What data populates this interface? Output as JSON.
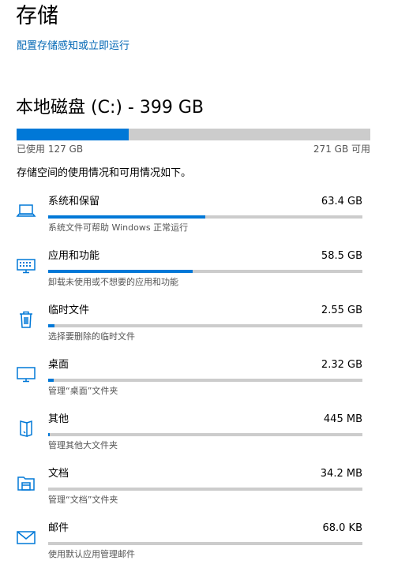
{
  "header": {
    "title": "存储",
    "config_link": "配置存储感知或立即运行"
  },
  "drive": {
    "title": "本地磁盘 (C:) - 399 GB",
    "used_label": "已使用 127 GB",
    "free_label": "271 GB 可用",
    "used_fraction": 0.318,
    "description": "存储空间的使用情况和可用情况如下。"
  },
  "accent_color": "#0078d7",
  "categories": [
    {
      "icon": "laptop-icon",
      "name": "系统和保留",
      "size": "63.4 GB",
      "desc": "系统文件可帮助 Windows 正常运行",
      "fraction": 0.5
    },
    {
      "icon": "apps-icon",
      "name": "应用和功能",
      "size": "58.5 GB",
      "desc": "卸载未使用或不想要的应用和功能",
      "fraction": 0.46
    },
    {
      "icon": "trash-icon",
      "name": "临时文件",
      "size": "2.55 GB",
      "desc": "选择要删除的临时文件",
      "fraction": 0.02
    },
    {
      "icon": "desktop-icon",
      "name": "桌面",
      "size": "2.32 GB",
      "desc": "管理“桌面”文件夹",
      "fraction": 0.018
    },
    {
      "icon": "other-icon",
      "name": "其他",
      "size": "445 MB",
      "desc": "管理其他大文件夹",
      "fraction": 0.004
    },
    {
      "icon": "documents-icon",
      "name": "文档",
      "size": "34.2 MB",
      "desc": "管理“文档”文件夹",
      "fraction": 0.0
    },
    {
      "icon": "mail-icon",
      "name": "邮件",
      "size": "68.0 KB",
      "desc": "使用默认应用管理邮件",
      "fraction": 0.0
    }
  ]
}
